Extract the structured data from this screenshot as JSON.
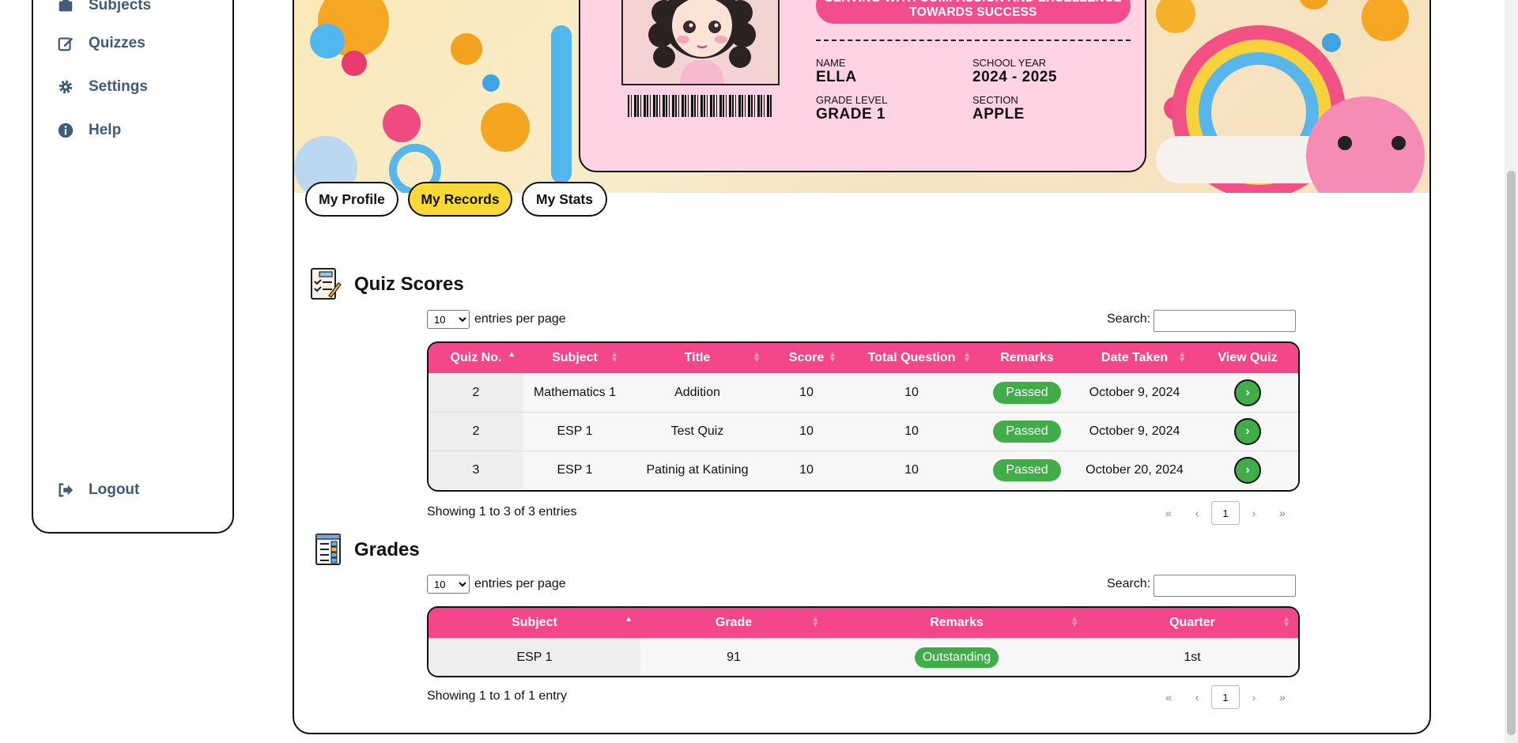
{
  "sidebar": {
    "items": [
      {
        "label": "Subjects",
        "icon": "subjects-icon"
      },
      {
        "label": "Quizzes",
        "icon": "edit-icon"
      },
      {
        "label": "Settings",
        "icon": "gear-icon"
      },
      {
        "label": "Help",
        "icon": "info-icon"
      }
    ],
    "logout": "Logout"
  },
  "idcard": {
    "motto": "SERVING WITH COMPASSION AND EXCELLENCE TOWARDS SUCCESS",
    "name_label": "NAME",
    "name": "ELLA",
    "school_year_label": "SCHOOL YEAR",
    "school_year": "2024 - 2025",
    "grade_label": "GRADE LEVEL",
    "grade": "GRADE 1",
    "section_label": "SECTION",
    "section": "APPLE"
  },
  "tabs": [
    "My Profile",
    "My Records",
    "My Stats"
  ],
  "active_tab": "My Records",
  "quiz_scores": {
    "title": "Quiz Scores",
    "length_value": "10",
    "length_text": "entries per page",
    "search_label": "Search:",
    "columns": [
      "Quiz No.",
      "Subject",
      "Title",
      "Score",
      "Total Question",
      "Remarks",
      "Date Taken",
      "View Quiz"
    ],
    "rows": [
      {
        "quiz_no": "2",
        "subject": "Mathematics 1",
        "title": "Addition",
        "score": "10",
        "total": "10",
        "remarks": "Passed",
        "date": "October 9, 2024"
      },
      {
        "quiz_no": "2",
        "subject": "ESP 1",
        "title": "Test Quiz",
        "score": "10",
        "total": "10",
        "remarks": "Passed",
        "date": "October 9, 2024"
      },
      {
        "quiz_no": "3",
        "subject": "ESP 1",
        "title": "Patinig at Katining",
        "score": "10",
        "total": "10",
        "remarks": "Passed",
        "date": "October 20, 2024"
      }
    ],
    "info": "Showing 1 to 3 of 3 entries",
    "pager": {
      "first": "«",
      "prev": "‹",
      "page": "1",
      "next": "›",
      "last": "»"
    }
  },
  "grades": {
    "title": "Grades",
    "length_value": "10",
    "length_text": "entries per page",
    "search_label": "Search:",
    "columns": [
      "Subject",
      "Grade",
      "Remarks",
      "Quarter"
    ],
    "rows": [
      {
        "subject": "ESP 1",
        "grade": "91",
        "remarks": "Outstanding",
        "quarter": "1st"
      }
    ],
    "info": "Showing 1 to 1 of 1 entry",
    "pager": {
      "first": "«",
      "prev": "‹",
      "page": "1",
      "next": "›",
      "last": "»"
    }
  },
  "colors": {
    "accent_pink": "#f3478a",
    "tab_active": "#fbd935",
    "badge_green": "#41ad49",
    "nav_text": "#3e5b77"
  }
}
